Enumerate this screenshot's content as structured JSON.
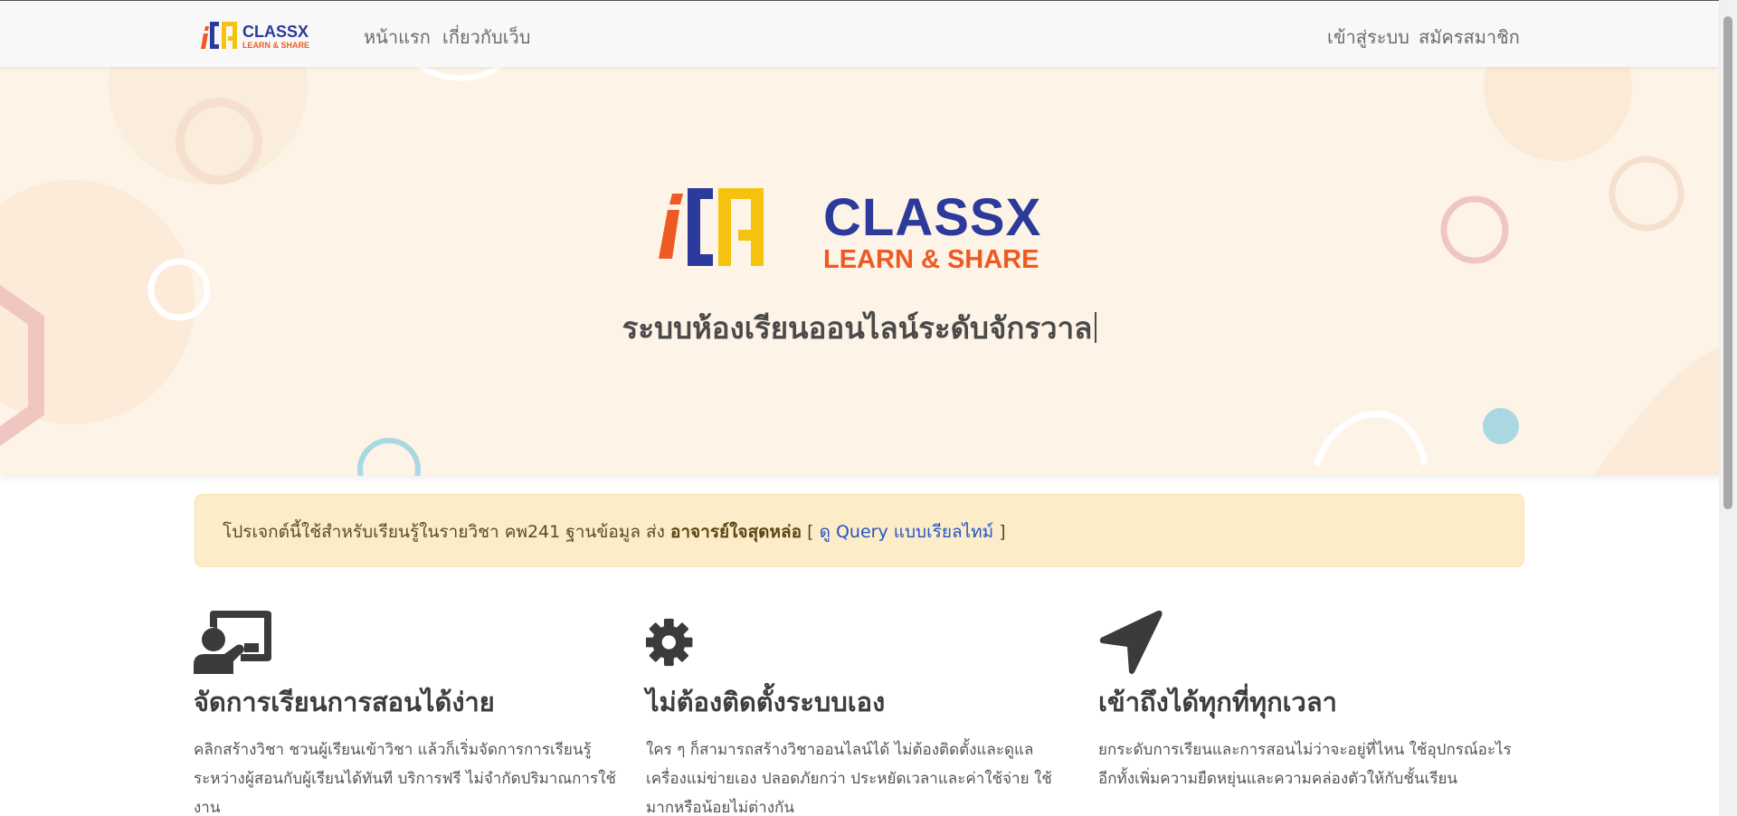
{
  "nav": {
    "logo_text": "CLASSX",
    "logo_subtext": "LEARN & SHARE",
    "home": "หน้าแรก",
    "about": "เกี่ยวกับเว็บ",
    "login": "เข้าสู่ระบบ",
    "register": "สมัครสมาชิก"
  },
  "hero": {
    "logo_text": "CLASSX",
    "logo_subtext": "LEARN & SHARE",
    "tagline": "ระบบห้องเรียนออนไลน์ระดับจักรวาล"
  },
  "alert": {
    "text": "โปรเจกต์นี้ใช้สำหรับเรียนรู้ในรายวิชา คพ241 ฐานข้อมูล ส่ง",
    "teacher": "อาจารย์ใจสุดหล่อ",
    "bracket_open": " [ ",
    "link": "ดู Query แบบเรียลไทม์",
    "bracket_close": " ]"
  },
  "features": [
    {
      "icon": "chalkboard-teacher-icon",
      "title": "จัดการเรียนการสอนได้ง่าย",
      "text": "คลิกสร้างวิชา ชวนผู้เรียนเข้าวิชา แล้วก็เริ่มจัดการการเรียนรู้ระหว่างผู้สอนกับผู้เรียนได้ทันที บริการฟรี ไม่จำกัดปริมาณการใช้งาน"
    },
    {
      "icon": "gear-icon",
      "title": "ไม่ต้องติดตั้งระบบเอง",
      "text": "ใคร ๆ ก็สามารถสร้างวิชาออนไลน์ได้ ไม่ต้องติดตั้งและดูแลเครื่องแม่ข่ายเอง ปลอดภัยกว่า ประหยัดเวลาและค่าใช้จ่าย ใช้มากหรือน้อยไม่ต่างกัน"
    },
    {
      "icon": "location-arrow-icon",
      "title": "เข้าถึงได้ทุกที่ทุกเวลา",
      "text": "ยกระดับการเรียนและการสอนไม่ว่าจะอยู่ที่ไหน ใช้อุปกรณ์อะไร อีกทั้งเพิ่มความยืดหยุ่นและความคล่องตัวให้กับชั้นเรียน"
    }
  ],
  "colors": {
    "logo_blue": "#2b3a9b",
    "logo_yellow": "#f5c20f",
    "logo_orange": "#ee5a24",
    "logo_purple": "#9a2c7e",
    "hero_bg": "#fdf3e6",
    "alert_bg": "#fdecc8",
    "link": "#2355c6"
  }
}
